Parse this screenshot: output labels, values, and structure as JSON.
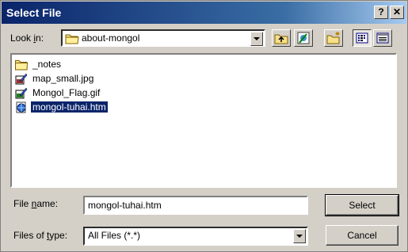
{
  "window": {
    "title": "Select File",
    "help_label": "?",
    "close_label": "✕"
  },
  "look_in": {
    "label_prefix": "Look ",
    "label_hotkey": "i",
    "label_suffix": "n:",
    "value": "about-mongol",
    "icon": "folder-icon"
  },
  "toolbar": {
    "buttons": [
      "up-one-level",
      "browse-web",
      "create-new-folder",
      "list-view",
      "details-view"
    ]
  },
  "files": [
    {
      "name": "_notes",
      "icon": "folder-icon",
      "selected": false
    },
    {
      "name": "map_small.jpg",
      "icon": "image-icon",
      "selected": false
    },
    {
      "name": "Mongol_Flag.gif",
      "icon": "image-icon",
      "selected": false
    },
    {
      "name": "mongol-tuhai.htm",
      "icon": "html-file-icon",
      "selected": true
    }
  ],
  "file_name": {
    "label_prefix": "File ",
    "label_hotkey": "n",
    "label_suffix": "ame:",
    "value": "mongol-tuhai.htm"
  },
  "files_of_type": {
    "label_prefix": "Files of ",
    "label_hotkey": "t",
    "label_suffix": "ype:",
    "value": "All Files (*.*)"
  },
  "buttons": {
    "select_label": "Select",
    "cancel_label": "Cancel"
  },
  "colors": {
    "title_bar": "#0a246a",
    "face": "#d4d0c8",
    "selection": "#0a246a"
  }
}
